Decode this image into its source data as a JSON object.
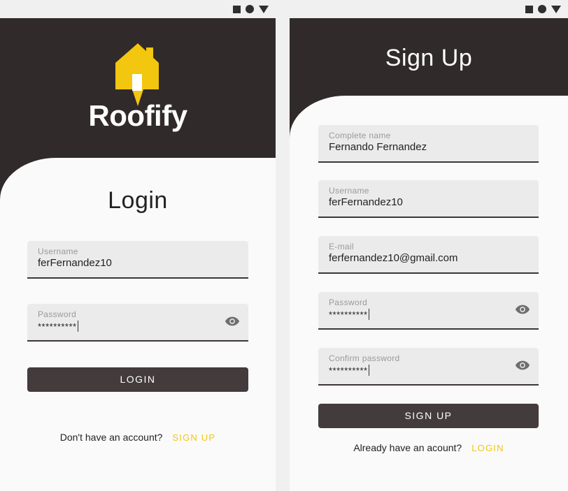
{
  "login": {
    "brand": "Roofify",
    "title": "Login",
    "username": {
      "label": "Username",
      "value": "ferFernandez10"
    },
    "password": {
      "label": "Password",
      "value": "**********"
    },
    "button": "LOGIN",
    "footer_text": "Don't have an account?",
    "footer_link": "SIGN UP"
  },
  "signup": {
    "title": "Sign Up",
    "complete_name": {
      "label": "Complete name",
      "value": "Fernando Fernandez"
    },
    "username": {
      "label": "Username",
      "value": "ferFernandez10"
    },
    "email": {
      "label": "E-mail",
      "value": "ferfernandez10@gmail.com"
    },
    "password": {
      "label": "Password",
      "value": "**********"
    },
    "confirm_password": {
      "label": "Confirm password",
      "value": "**********"
    },
    "button": "SIGN UP",
    "footer_text": "Already have an acount?",
    "footer_link": "LOGIN"
  },
  "status_icons": [
    "stop-icon",
    "record-icon",
    "triangle-down-icon"
  ],
  "colors": {
    "dark": "#312a2b",
    "accent": "#f3c60f",
    "button": "#433b3c",
    "field": "#ebebeb"
  }
}
